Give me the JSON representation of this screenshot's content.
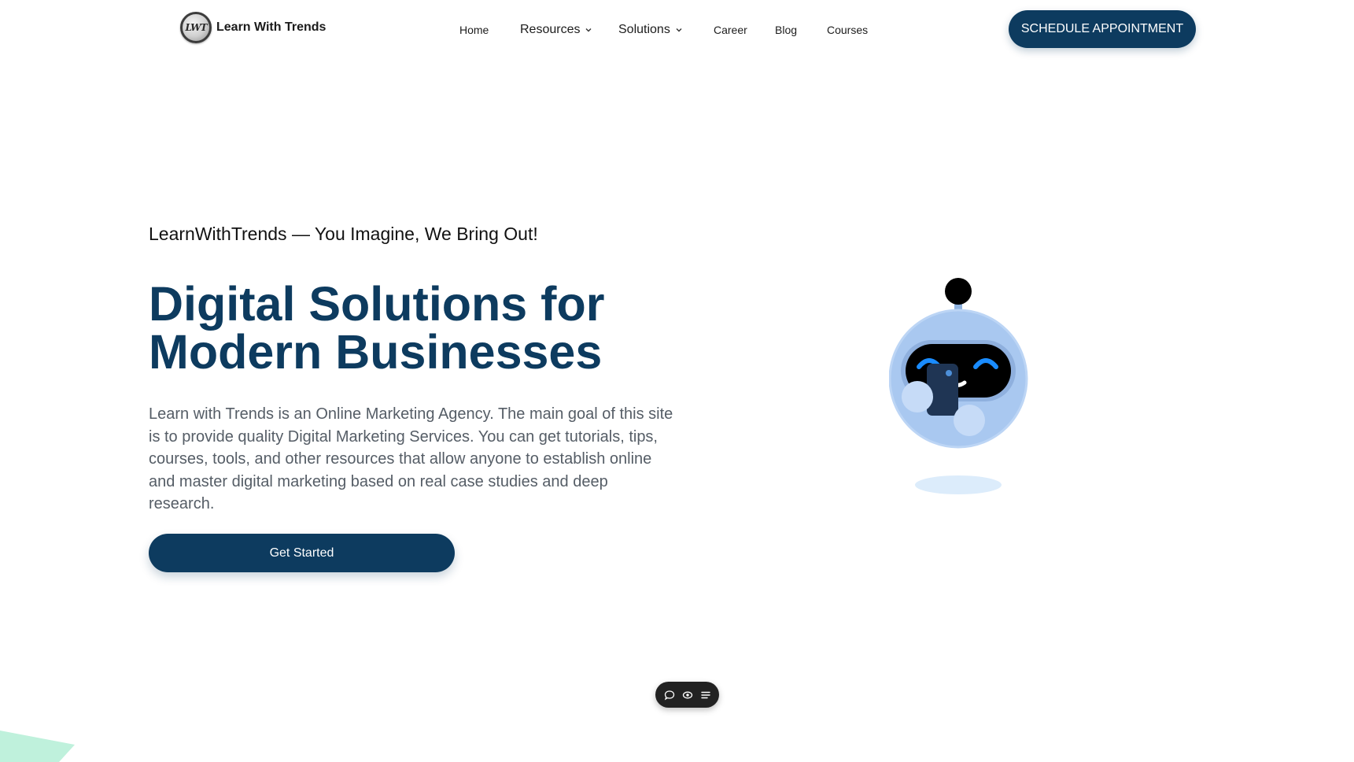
{
  "header": {
    "logo_badge": "LWT",
    "logo_text": "Learn With Trends",
    "nav": [
      {
        "label": "Home",
        "has_dropdown": false
      },
      {
        "label": "Resources",
        "has_dropdown": true
      },
      {
        "label": "Solutions",
        "has_dropdown": true
      },
      {
        "label": "Career",
        "has_dropdown": false
      },
      {
        "label": "Blog",
        "has_dropdown": false
      },
      {
        "label": "Courses",
        "has_dropdown": false
      }
    ],
    "cta_label": "SCHEDULE APPOINTMENT"
  },
  "hero": {
    "tagline": "LearnWithTrends — You Imagine, We Bring Out!",
    "headline_line1": "Digital Solutions for",
    "headline_line2": "Modern Businesses",
    "description": "Learn with Trends is an Online Marketing Agency. The main goal of this site is to provide quality Digital Marketing Services. You can get tutorials, tips, courses, tools, and other resources that allow anyone to establish online and master digital marketing based on real case studies and deep research.",
    "cta_label": "Get Started"
  },
  "toolbar": {
    "icons": [
      "chat-bubble-icon",
      "eye-icon",
      "menu-list-icon"
    ]
  },
  "colors": {
    "brand": "#0d3b5f",
    "robot_body": "#a9c8f0",
    "robot_eye": "#1a8cff"
  }
}
